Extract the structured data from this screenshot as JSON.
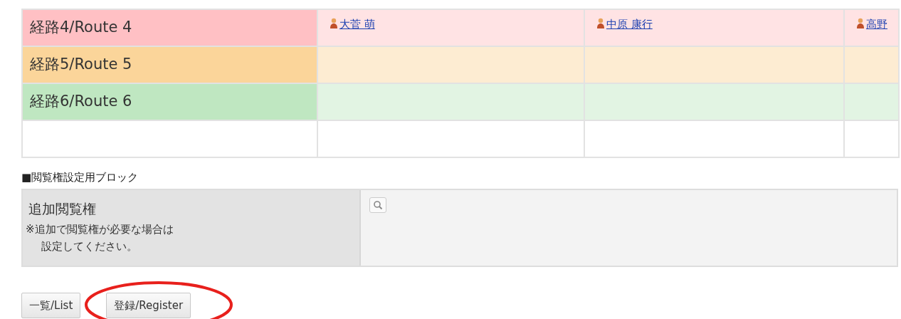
{
  "routes": [
    {
      "label": "経路4/Route 4",
      "color": "#ffc0c4",
      "cells": [
        {
          "users": [
            "大菅 萌"
          ]
        },
        {
          "users": [
            "中原 康行"
          ]
        },
        {
          "users": [
            "高野"
          ]
        }
      ]
    },
    {
      "label": "経路5/Route 5",
      "color": "#fbd59a"
    },
    {
      "label": "経路6/Route 6",
      "color": "#bfe7c1"
    }
  ],
  "section_title": "■閲覧権設定用ブロック",
  "access": {
    "label": "追加閲覧権",
    "note": "※追加で閲覧権が必要な場合は",
    "note_2": "設定してください。"
  },
  "buttons": [
    {
      "label": "一覧/List",
      "highlighted": false
    },
    {
      "label": "登録/Register",
      "highlighted": true
    }
  ]
}
